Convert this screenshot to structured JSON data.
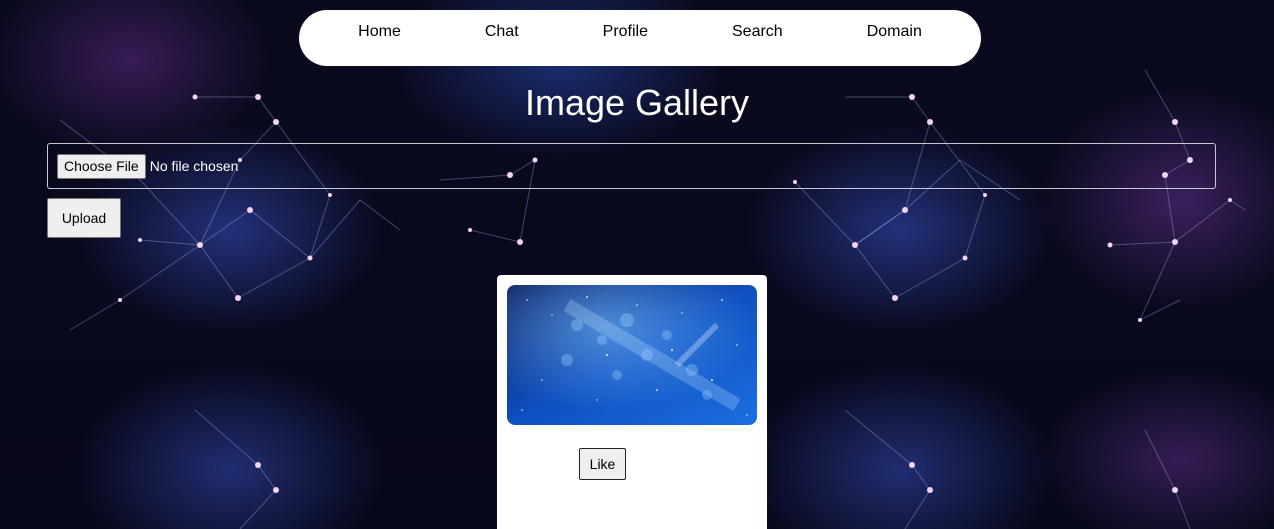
{
  "nav": {
    "items": [
      "Home",
      "Chat",
      "Profile",
      "Search",
      "Domain"
    ]
  },
  "page": {
    "title": "Image Gallery"
  },
  "upload_form": {
    "choose_file_label": "Choose File",
    "file_status": "No file chosen",
    "upload_label": "Upload"
  },
  "gallery": {
    "cards": [
      {
        "like_label": "Like",
        "image_icon": "starfield-image"
      }
    ]
  },
  "colors": {
    "background": "#07081a",
    "accent_blue": "#3a52c8",
    "node_pink": "#e8a0d8",
    "nav_bg": "#ffffff",
    "title_text": "#ffffff"
  }
}
